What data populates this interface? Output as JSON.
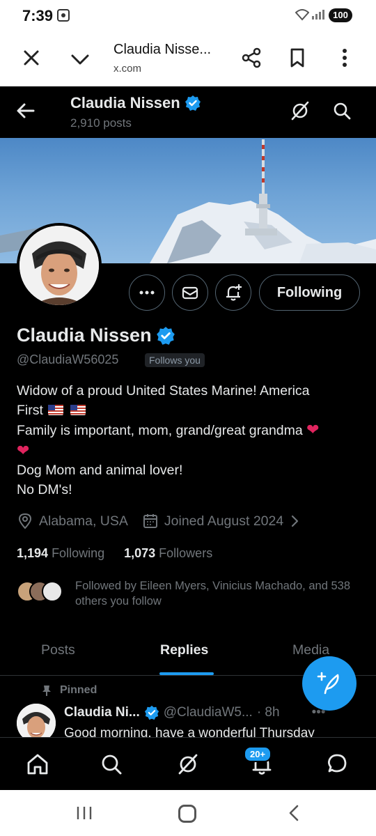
{
  "status_bar": {
    "time": "7:39",
    "battery": "100"
  },
  "browser": {
    "title": "Claudia Nisse...",
    "url": "x.com"
  },
  "header": {
    "name": "Claudia Nissen",
    "posts": "2,910 posts"
  },
  "profile": {
    "name": "Claudia Nissen",
    "handle": "@ClaudiaW56025",
    "follows_you": "Follows you",
    "follow_button": "Following",
    "bio": {
      "line1": "Widow of a  proud United States Marine!  America",
      "line2": "First",
      "line3": "Family is important, mom, grand/great grandma",
      "line4": "Dog Mom and animal lover!",
      "line5": "No DM's!"
    },
    "location": "Alabama, USA",
    "joined": "Joined August 2024",
    "following_count": "1,194",
    "following_label": "Following",
    "followers_count": "1,073",
    "followers_label": "Followers",
    "followed_by": "Followed by Eileen Myers, Vinicius Machado, and 538 others you follow"
  },
  "tabs": [
    {
      "label": "Posts",
      "active": false
    },
    {
      "label": "Replies",
      "active": true
    },
    {
      "label": "Media",
      "active": false
    }
  ],
  "pinned_tweet": {
    "pinned_label": "Pinned",
    "name": "Claudia Ni...",
    "handle": "@ClaudiaW5...",
    "time": "· 8h",
    "text": "Good morning, have a wonderful Thursday"
  },
  "bottom_nav": {
    "notifications_badge": "20+"
  },
  "colors": {
    "accent": "#1d9bf0",
    "background": "#000000",
    "muted": "#71767b"
  }
}
